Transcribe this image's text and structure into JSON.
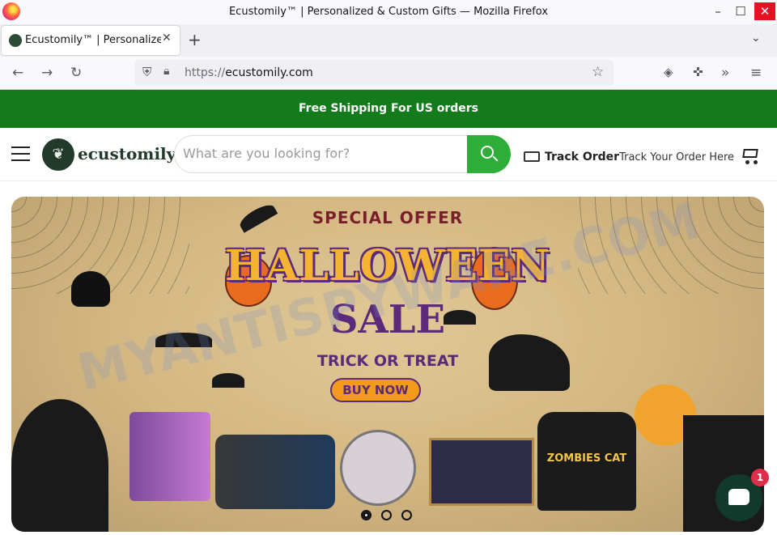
{
  "window": {
    "title": "Ecustomily™ | Personalized & Custom Gifts — Mozilla Firefox",
    "min_glyph": "–",
    "max_glyph": "☐",
    "close_glyph": "✕"
  },
  "tabs": {
    "active_title": "Ecustomily™ | Personalized & Custom Gifts",
    "close_glyph": "✕",
    "new_tab_glyph": "+",
    "list_glyph": "⌄"
  },
  "navbar": {
    "back_glyph": "←",
    "forward_glyph": "→",
    "reload_glyph": "↻",
    "url_protocol": "https://",
    "url_host": "ecustomily.com",
    "bookmark_glyph": "☆",
    "menu_glyph": "≡",
    "extensions_glyph": "»"
  },
  "announcement": "Free Shipping For US orders",
  "header": {
    "logo_text": "ecustomily",
    "search_placeholder": "What are you looking for?",
    "track_title": "Track Order",
    "track_sub": "Track Your Order Here"
  },
  "banner": {
    "special": "SPECIAL OFFER",
    "headline": "HALLOWEEN",
    "sale": "SALE",
    "tagline": "TRICK OR TREAT",
    "cta": "BUY NOW",
    "shirt_text": "ZOMBIES CAT",
    "slides": 3,
    "active_slide": 1
  },
  "chat": {
    "badge_count": "1"
  },
  "watermark": "MYANTISPYWARE.COM",
  "colors": {
    "announcement_bg": "#137b1c",
    "search_button": "#2ead39",
    "chat_button": "#123a2c",
    "badge": "#e02d4b"
  }
}
